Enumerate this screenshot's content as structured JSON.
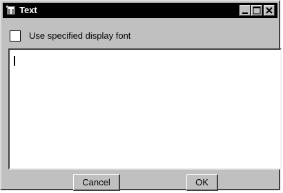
{
  "window": {
    "title": "Text",
    "icon": "app-icon"
  },
  "controls": {
    "minimize_icon": "minimize-icon",
    "maximize_icon": "maximize-icon",
    "close_icon": "close-icon"
  },
  "form": {
    "checkbox_label": "Use specified display font",
    "checkbox_checked": false,
    "text_value": ""
  },
  "buttons": {
    "cancel": "Cancel",
    "ok": "OK"
  },
  "colors": {
    "titlebar_bg": "#000000",
    "window_bg": "#c0c0c0"
  }
}
